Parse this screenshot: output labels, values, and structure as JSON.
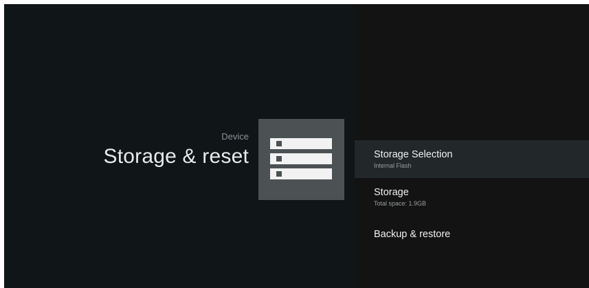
{
  "header": {
    "breadcrumb": "Device",
    "title": "Storage & reset",
    "icon": "storage-icon"
  },
  "menu": {
    "items": [
      {
        "title": "Storage Selection",
        "subtitle": "Internal Flash",
        "selected": true
      },
      {
        "title": "Storage",
        "subtitle": "Total space: 1.9GB",
        "selected": false
      },
      {
        "title": "Backup & restore",
        "subtitle": "",
        "selected": false
      }
    ]
  },
  "colors": {
    "background": "#0f1417",
    "panel": "#131313",
    "selected_row": "#22272a",
    "icon_box": "#4c5153"
  }
}
